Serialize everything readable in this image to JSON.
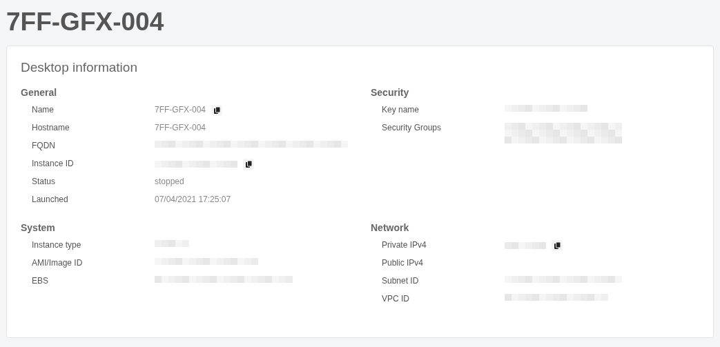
{
  "page_title": "7FF-GFX-004",
  "card": {
    "title": "Desktop information",
    "sections": [
      {
        "title": "General",
        "rows": [
          {
            "label": "Name",
            "value": {
              "kind": "text",
              "text": "7FF-GFX-004"
            },
            "copyable": true
          },
          {
            "label": "Hostname",
            "value": {
              "kind": "text",
              "text": "7FF-GFX-004"
            },
            "copyable": false
          },
          {
            "label": "FQDN",
            "value": {
              "kind": "redacted"
            },
            "copyable": false
          },
          {
            "label": "Instance ID",
            "value": {
              "kind": "redacted"
            },
            "copyable": true
          },
          {
            "label": "Status",
            "value": {
              "kind": "text",
              "text": "stopped"
            },
            "copyable": false
          },
          {
            "label": "Launched",
            "value": {
              "kind": "text",
              "text": "07/04/2021 17:25:07"
            },
            "copyable": false
          }
        ]
      },
      {
        "title": "Security",
        "rows": [
          {
            "label": "Key name",
            "value": {
              "kind": "redacted"
            },
            "copyable": false
          },
          {
            "label": "Security Groups",
            "value": {
              "kind": "redacted_block"
            },
            "copyable": false
          }
        ]
      },
      {
        "title": "System",
        "rows": [
          {
            "label": "Instance type",
            "value": {
              "kind": "redacted"
            },
            "copyable": false
          },
          {
            "label": "AMI/Image ID",
            "value": {
              "kind": "redacted"
            },
            "copyable": false
          },
          {
            "label": "EBS",
            "value": {
              "kind": "redacted"
            },
            "copyable": false
          }
        ]
      },
      {
        "title": "Network",
        "rows": [
          {
            "label": "Private IPv4",
            "value": {
              "kind": "redacted"
            },
            "copyable": true
          },
          {
            "label": "Public IPv4",
            "copyable": false
          },
          {
            "label": "Subnet ID",
            "value": {
              "kind": "redacted"
            },
            "copyable": false
          },
          {
            "label": "VPC ID",
            "value": {
              "kind": "redacted"
            },
            "copyable": false
          }
        ]
      }
    ]
  }
}
